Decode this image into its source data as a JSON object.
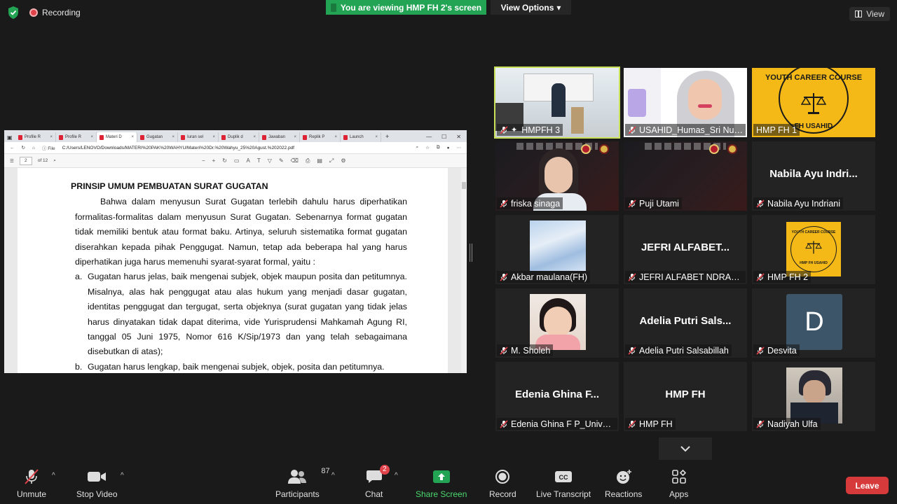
{
  "top": {
    "recording_label": "Recording",
    "viewing_banner": "You are viewing HMP FH 2's screen",
    "view_options_label": "View Options",
    "view_label": "View"
  },
  "shared_screen": {
    "tabs": [
      "Profile R",
      "Profile R",
      "Materi D",
      "Gugatan",
      "Iuran sel",
      "Duplik d",
      "Jawaban",
      "Replik P",
      "Launch"
    ],
    "window_controls": [
      "—",
      "☐",
      "✕"
    ],
    "address": {
      "file_label": "File",
      "url": "C:/Users/LENOVO/Downloads/MATERI%20PAK%20WAHYU/Materi%20Dr.%20Wahyu_25%20Agust.%202022.pdf"
    },
    "pdf_toolbar": {
      "page_value": "2",
      "page_total": "of 12"
    },
    "document": {
      "heading": "PRINSIP UMUM PEMBUATAN SURAT GUGATAN",
      "paragraph": "Bahwa dalam menyusun Surat Gugatan terlebih dahulu harus diperhatikan formalitas-formalitas dalam menyusun Surat Gugatan. Sebenarnya format gugatan tidak memiliki bentuk atau format baku. Artinya, seluruh sistematika format gugatan diserahkan kepada pihak Penggugat. Namun, tetap ada beberapa hal yang harus diperhatikan juga harus memenuhi syarat-syarat formal, yaitu :",
      "items": [
        {
          "marker": "a.",
          "text": "Gugatan harus jelas, baik mengenai subjek, objek maupun posita  dan petitumnya. Misalnya, alas hak penggugat atau alas hukum yang menjadi dasar gugatan, identitas penggugat dan tergugat, serta objeknya (surat gugatan yang tidak jelas harus dinyatakan tidak dapat diterima, vide Yurisprudensi Mahkamah Agung RI, tanggal 05 Juni 1975, Nomor 616 K/Sip/1973 dan yang telah sebagaimana disebutkan di atas);"
        },
        {
          "marker": "b.",
          "text": "Gugatan harus lengkap, baik mengenai subjek, objek, posita dan petitumnya."
        }
      ]
    }
  },
  "participants": [
    {
      "name": "HMPFH 3",
      "type": "video-room",
      "active": true
    },
    {
      "name": "USAHID_Humas_Sri Nursyamsiah",
      "type": "video-woman"
    },
    {
      "name": "HMP FH 1",
      "type": "logo-large",
      "logo_text": "YOUTH CAREER COURSE",
      "logo_sub": "FH USAHID"
    },
    {
      "name": "friska sinaga",
      "type": "video-poster"
    },
    {
      "name": "Puji Utami",
      "type": "poster"
    },
    {
      "name": "Nabila Ayu Indriani",
      "big": "Nabila Ayu Indri...",
      "type": "name"
    },
    {
      "name": "Akbar maulana(FH)",
      "type": "photo-sky"
    },
    {
      "name": "JEFRI ALFABET NDRAHA",
      "big": "JEFRI ALFABET...",
      "type": "name"
    },
    {
      "name": "HMP FH 2",
      "type": "logo-small",
      "logo_text": "YOUTH CAREER COURSE",
      "logo_sub": "HMP FH USAHID"
    },
    {
      "name": "M. Sholeh",
      "type": "photo-child"
    },
    {
      "name": "Adelia Putri Salsabillah",
      "big": "Adelia Putri Sals...",
      "type": "name"
    },
    {
      "name": "Desvita",
      "type": "avatar",
      "initial": "D"
    },
    {
      "name": "Edenia Ghina F P_Universitas Sahid",
      "big": "Edenia Ghina F...",
      "type": "name"
    },
    {
      "name": "HMP FH",
      "big": "HMP FH",
      "type": "name"
    },
    {
      "name": "Nadiyah Ulfa",
      "type": "photo-anime"
    }
  ],
  "toolbar": {
    "unmute": "Unmute",
    "stop_video": "Stop Video",
    "participants": "Participants",
    "participants_count": "87",
    "chat": "Chat",
    "chat_badge": "2",
    "share_screen": "Share Screen",
    "record": "Record",
    "live_transcript": "Live Transcript",
    "reactions": "Reactions",
    "apps": "Apps",
    "leave": "Leave"
  },
  "colors": {
    "banner_green": "#23a455",
    "active_speaker": "#c9e15a",
    "leave_red": "#d63a3a",
    "share_green": "#4ad86d",
    "muted_red": "#e0424a",
    "avatar_blue": "#3c5568",
    "logo_yellow": "#f4b917"
  }
}
